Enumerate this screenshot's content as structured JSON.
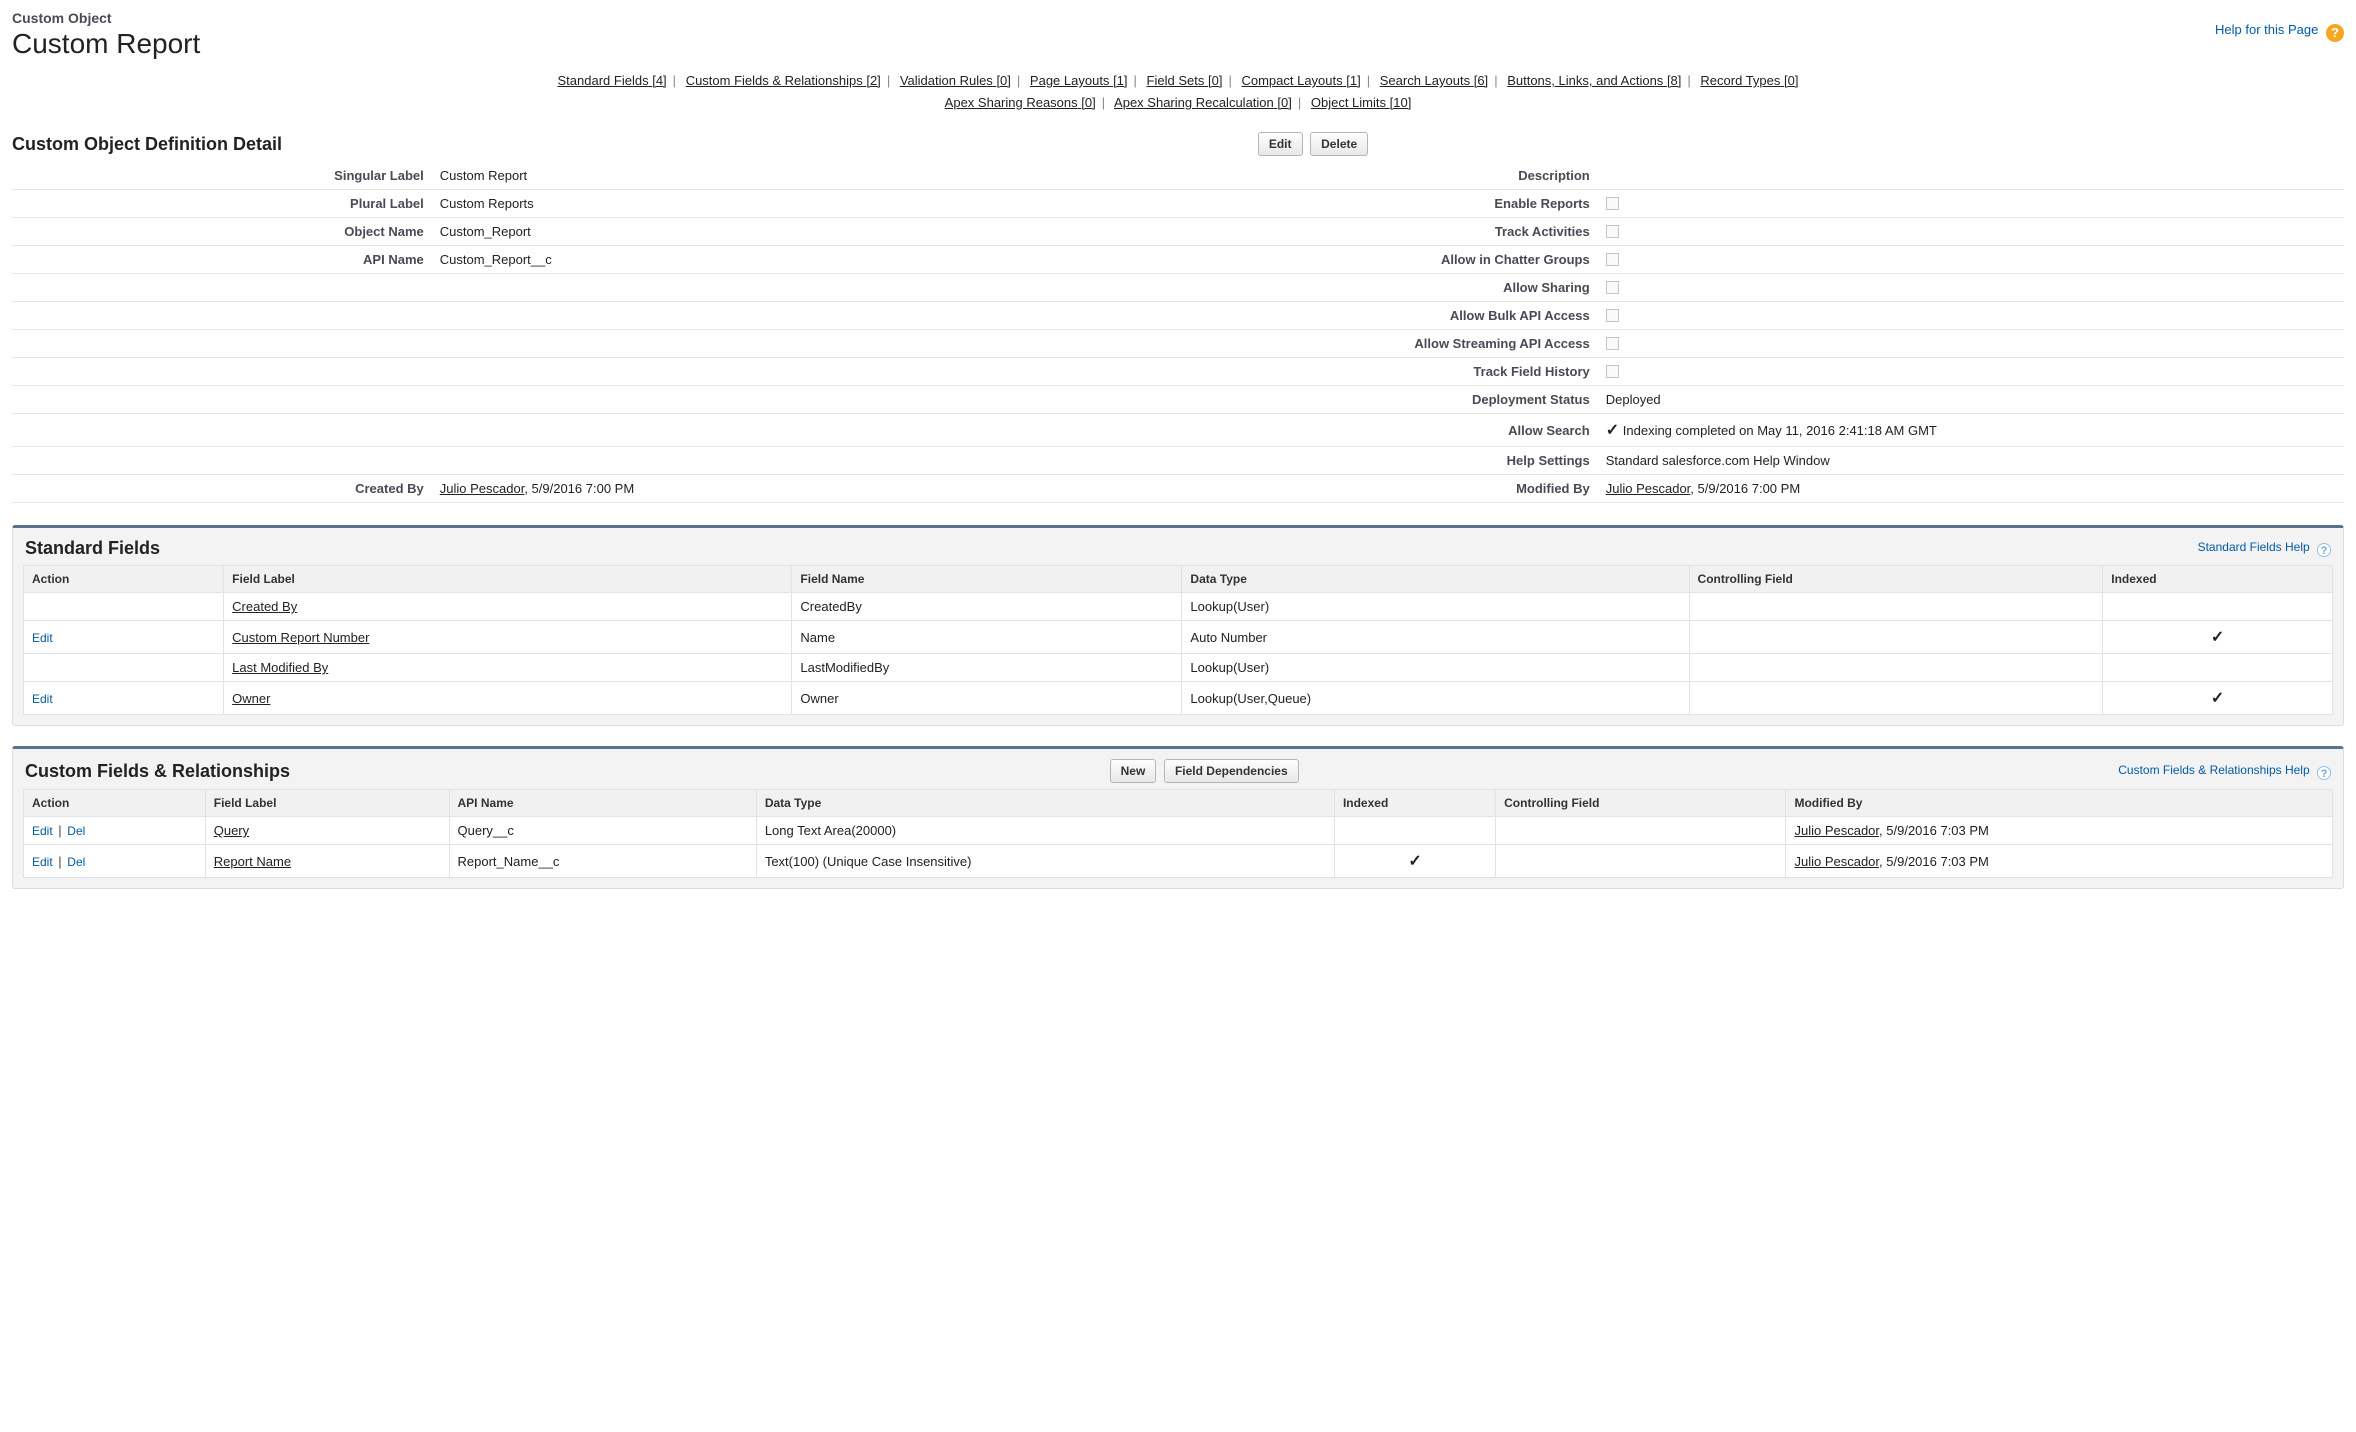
{
  "header": {
    "subtitle": "Custom Object",
    "title": "Custom Report",
    "help_label": "Help for this Page"
  },
  "nav": [
    {
      "label": "Standard Fields",
      "count": "[4]"
    },
    {
      "label": "Custom Fields & Relationships",
      "count": "[2]"
    },
    {
      "label": "Validation Rules",
      "count": "[0]"
    },
    {
      "label": "Page Layouts",
      "count": "[1]"
    },
    {
      "label": "Field Sets",
      "count": "[0]"
    },
    {
      "label": "Compact Layouts",
      "count": "[1]"
    },
    {
      "label": "Search Layouts",
      "count": "[6]"
    },
    {
      "label": "Buttons, Links, and Actions",
      "count": "[8]"
    },
    {
      "label": "Record Types",
      "count": "[0]"
    },
    {
      "label": "Apex Sharing Reasons",
      "count": "[0]"
    },
    {
      "label": "Apex Sharing Recalculation",
      "count": "[0]"
    },
    {
      "label": "Object Limits",
      "count": "[10]"
    }
  ],
  "detail": {
    "section_title": "Custom Object Definition Detail",
    "edit_label": "Edit",
    "delete_label": "Delete",
    "labels": {
      "singular": "Singular Label",
      "plural": "Plural Label",
      "objname": "Object Name",
      "apiname": "API Name",
      "desc": "Description",
      "enable_reports": "Enable Reports",
      "track_activities": "Track Activities",
      "allow_chatter": "Allow in Chatter Groups",
      "allow_sharing": "Allow Sharing",
      "allow_bulk": "Allow Bulk API Access",
      "allow_stream": "Allow Streaming API Access",
      "track_field_hist": "Track Field History",
      "deploy_status": "Deployment Status",
      "allow_search": "Allow Search",
      "help_settings": "Help Settings",
      "created_by": "Created By",
      "modified_by": "Modified By"
    },
    "values": {
      "singular": "Custom Report",
      "plural": "Custom Reports",
      "objname": "Custom_Report",
      "apiname": "Custom_Report__c",
      "deploy_status": "Deployed",
      "allow_search_note": "Indexing completed on May 11, 2016 2:41:18 AM GMT",
      "help_settings": "Standard salesforce.com Help Window",
      "created_by_user": "Julio Pescador",
      "created_by_date": ", 5/9/2016 7:00 PM",
      "modified_by_user": "Julio Pescador",
      "modified_by_date": ", 5/9/2016 7:00 PM"
    }
  },
  "standard_fields": {
    "title": "Standard Fields",
    "help_label": "Standard Fields Help",
    "columns": [
      "Action",
      "Field Label",
      "Field Name",
      "Data Type",
      "Controlling Field",
      "Indexed"
    ],
    "rows": [
      {
        "action": "",
        "label": "Created By",
        "name": "CreatedBy",
        "type": "Lookup(User)",
        "ctrl": "",
        "indexed": false
      },
      {
        "action": "Edit",
        "label": "Custom Report Number",
        "name": "Name",
        "type": "Auto Number",
        "ctrl": "",
        "indexed": true
      },
      {
        "action": "",
        "label": "Last Modified By",
        "name": "LastModifiedBy",
        "type": "Lookup(User)",
        "ctrl": "",
        "indexed": false
      },
      {
        "action": "Edit",
        "label": "Owner",
        "name": "Owner",
        "type": "Lookup(User,Queue)",
        "ctrl": "",
        "indexed": true
      }
    ]
  },
  "custom_fields": {
    "title": "Custom Fields & Relationships",
    "new_label": "New",
    "fdep_label": "Field Dependencies",
    "help_label": "Custom Fields & Relationships Help",
    "columns": [
      "Action",
      "Field Label",
      "API Name",
      "Data Type",
      "Indexed",
      "Controlling Field",
      "Modified By"
    ],
    "action_edit": "Edit",
    "action_del": "Del",
    "rows": [
      {
        "label": "Query",
        "api": "Query__c",
        "type": "Long Text Area(20000)",
        "indexed": false,
        "ctrl": "",
        "mod_user": "Julio Pescador",
        "mod_date": ", 5/9/2016 7:03 PM"
      },
      {
        "label": "Report Name",
        "api": "Report_Name__c",
        "type": "Text(100) (Unique Case Insensitive)",
        "indexed": true,
        "ctrl": "",
        "mod_user": "Julio Pescador",
        "mod_date": ", 5/9/2016 7:03 PM"
      }
    ]
  }
}
